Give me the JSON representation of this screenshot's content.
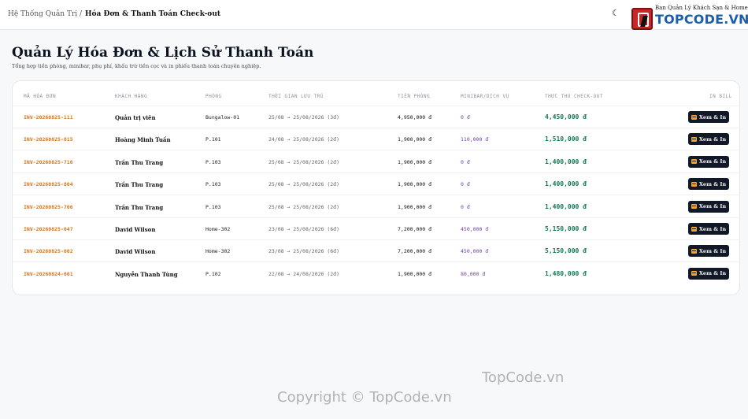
{
  "header": {
    "breadcrumb_parent": "Hệ Thống Quản Trị /",
    "breadcrumb_current": "Hóa Đơn & Thanh Toán Check-out",
    "theme_icon": "moon-icon",
    "logo": {
      "tagline": "Ban Quản Lý Khách Sạn & Homestay",
      "brand": "TOPCODE.VN",
      "brand_color": "#1c5ea8"
    }
  },
  "page": {
    "title": "Quản Lý Hóa Đơn & Lịch Sử Thanh Toán",
    "subtitle": "Tổng hợp tiền phòng, minibar, phụ phí, khấu trừ tiền cọc và in phiếu thanh toán chuyên nghiệp."
  },
  "table": {
    "columns": [
      "MÃ HÓA ĐƠN",
      "KHÁCH HÀNG",
      "PHÒNG",
      "THỜI GIAN LƯU TRÚ",
      "TIỀN PHÒNG",
      "MINIBAR/DỊCH VỤ",
      "THỰC THU CHECK-OUT",
      "IN BILL"
    ],
    "print_label": "Xem & In",
    "print_icon": "printer-icon",
    "rows": [
      {
        "invoice": "INV-20260825-111",
        "customer": "Quản trị viên",
        "room": "Bungalow-01",
        "stay": "25/08 → 25/08/2026 (3đ)",
        "room_fee": "4,950,000 đ",
        "minibar": "0 đ",
        "total": "4,450,000 đ"
      },
      {
        "invoice": "INV-20260825-815",
        "customer": "Hoàng Minh Tuấn",
        "room": "P.101",
        "stay": "24/08 → 25/08/2026 (2đ)",
        "room_fee": "1,900,000 đ",
        "minibar": "110,000 đ",
        "total": "1,510,000 đ"
      },
      {
        "invoice": "INV-20260825-716",
        "customer": "Trần Thu Trang",
        "room": "P.103",
        "stay": "25/08 → 25/08/2026 (2đ)",
        "room_fee": "1,900,000 đ",
        "minibar": "0 đ",
        "total": "1,400,000 đ"
      },
      {
        "invoice": "INV-20260825-804",
        "customer": "Trần Thu Trang",
        "room": "P.103",
        "stay": "25/08 → 25/08/2026 (2đ)",
        "room_fee": "1,900,000 đ",
        "minibar": "0 đ",
        "total": "1,400,000 đ"
      },
      {
        "invoice": "INV-20260825-706",
        "customer": "Trần Thu Trang",
        "room": "P.103",
        "stay": "25/08 → 25/08/2026 (2đ)",
        "room_fee": "1,900,000 đ",
        "minibar": "0 đ",
        "total": "1,400,000 đ"
      },
      {
        "invoice": "INV-20260825-047",
        "customer": "David Wilson",
        "room": "Home-302",
        "stay": "23/08 → 25/08/2026 (6đ)",
        "room_fee": "7,200,000 đ",
        "minibar": "450,000 đ",
        "total": "5,150,000 đ"
      },
      {
        "invoice": "INV-20260825-002",
        "customer": "David Wilson",
        "room": "Home-302",
        "stay": "23/08 → 25/08/2026 (6đ)",
        "room_fee": "7,200,000 đ",
        "minibar": "450,000 đ",
        "total": "5,150,000 đ"
      },
      {
        "invoice": "INV-20260824-001",
        "customer": "Nguyễn Thanh Tùng",
        "room": "P.102",
        "stay": "22/08 → 24/08/2026 (2đ)",
        "room_fee": "1,900,000 đ",
        "minibar": "80,000 đ",
        "total": "1,480,000 đ"
      }
    ]
  },
  "watermark": {
    "line1": "TopCode.vn",
    "line2": "Copyright © TopCode.vn"
  }
}
